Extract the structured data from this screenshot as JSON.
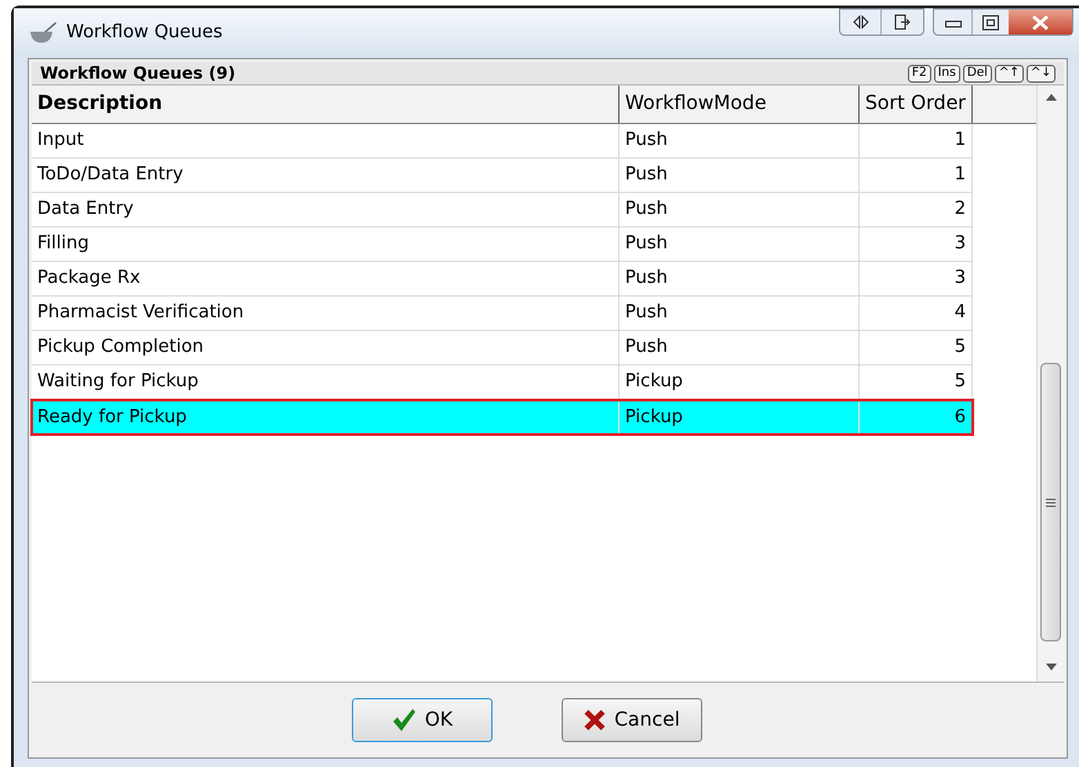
{
  "window": {
    "title": "Workflow Queues"
  },
  "grid": {
    "title": "Workflow Queues (9)",
    "shortcuts": [
      "F2",
      "Ins",
      "Del",
      "^↑",
      "^↓"
    ],
    "columns": [
      "Description",
      "WorkflowMode",
      "Sort Order"
    ],
    "rows": [
      {
        "cells": [
          "Input",
          "Push",
          "1"
        ],
        "selected": false
      },
      {
        "cells": [
          "ToDo/Data Entry",
          "Push",
          "1"
        ],
        "selected": false
      },
      {
        "cells": [
          "Data Entry",
          "Push",
          "2"
        ],
        "selected": false
      },
      {
        "cells": [
          "Filling",
          "Push",
          "3"
        ],
        "selected": false
      },
      {
        "cells": [
          "Package Rx",
          "Push",
          "3"
        ],
        "selected": false
      },
      {
        "cells": [
          "Pharmacist Verification",
          "Push",
          "4"
        ],
        "selected": false
      },
      {
        "cells": [
          "Pickup Completion",
          "Push",
          "5"
        ],
        "selected": false
      },
      {
        "cells": [
          "Waiting for Pickup",
          "Pickup",
          "5"
        ],
        "selected": false
      },
      {
        "cells": [
          "Ready for Pickup",
          "Pickup",
          "6"
        ],
        "selected": true
      }
    ]
  },
  "buttons": [
    {
      "label": "OK",
      "kind": "ok"
    },
    {
      "label": "Cancel",
      "kind": "cancel"
    }
  ]
}
